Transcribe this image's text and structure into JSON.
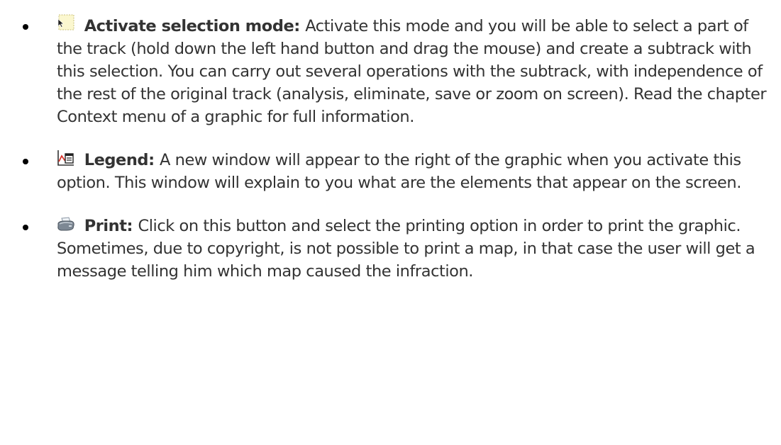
{
  "items": [
    {
      "icon": "selection-mode-icon",
      "term": "Activate selection mode:",
      "description": "Activate this mode and you will be able to select a part of the track (hold down the left hand button and drag the mouse) and create a subtrack with this selection. You can carry out several operations with the subtrack, with independence of the rest of the original track (analysis, eliminate, save or zoom on screen). Read the chapter Context menu of a graphic for full information."
    },
    {
      "icon": "legend-icon",
      "term": "Legend:",
      "description": "A new window will appear to the right of the graphic when you activate this option. This window will explain to you what are the elements that appear on the screen."
    },
    {
      "icon": "printer-icon",
      "term": "Print:",
      "description": "Click on this button and select the printing option in order to print the graphic. Sometimes, due to copyright, is not possible to print a map, in that case the user will get a message telling him which map caused the infraction."
    }
  ]
}
